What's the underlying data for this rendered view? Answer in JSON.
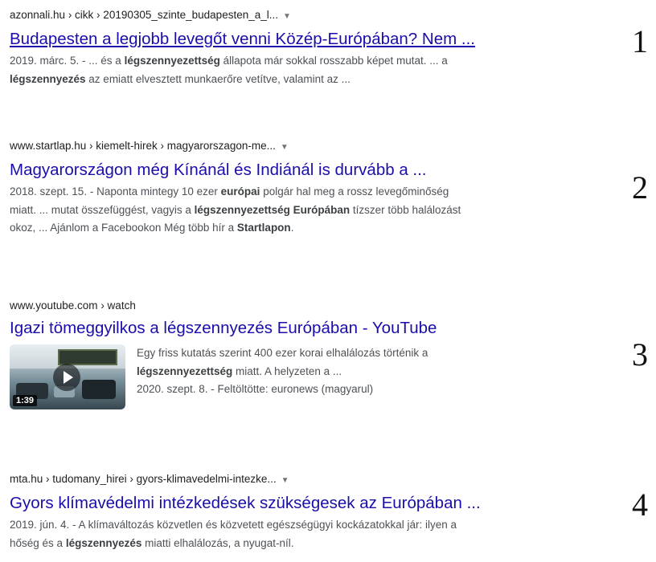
{
  "results": [
    {
      "domain": "azonnali.hu",
      "path": " › cikk › 20190305_szinte_budapesten_a_l...",
      "title": "Budapesten a legjobb levegőt venni Közép-Európában? Nem ...",
      "visited": true,
      "snippet_1a": "2019. márc. 5. - ... és a ",
      "snippet_1b": "légszennyezettség",
      "snippet_1c": " állapota már sokkal rosszabb képet mutat. ... a",
      "snippet_2a": "légszennyezés",
      "snippet_2b": " az emiatt elvesztett munkaerőre vetítve, valamint az ...",
      "number": "1"
    },
    {
      "domain": "www.startlap.hu",
      "path": " › kiemelt-hirek › magyarorszagon-me...",
      "title": "Magyarországon még Kínánál és Indiánál is durvább a ...",
      "snippet_1a": "2018. szept. 15. - Naponta mintegy 10 ezer ",
      "snippet_1b": "európai",
      "snippet_1c": " polgár hal meg a rossz levegőminőség",
      "snippet_2a": "miatt. ... mutat összefüggést, vagyis a ",
      "snippet_2b": "légszennyezettség Európában",
      "snippet_2c": " tízszer több halálozást",
      "snippet_3a": "okoz, ... Ajánlom a Facebookon Még több hír a ",
      "snippet_3b": "Startlapon",
      "snippet_3c": ".",
      "number": "2"
    },
    {
      "domain": "www.youtube.com",
      "path": " › watch",
      "title": "Igazi tömeggyilkos a légszennyezés Európában - YouTube",
      "video_line1": "Egy friss kutatás szerint 400 ezer korai elhalálozás történik a",
      "video_line2a": "légszennyezettség",
      "video_line2b": " miatt. A helyzeten a ...",
      "video_meta": "2020. szept. 8. - Feltöltötte: euronews (magyarul)",
      "duration": "1:39",
      "number": "3"
    },
    {
      "domain": "mta.hu",
      "path": " › tudomany_hirei › gyors-klimavedelmi-intezke...",
      "title": "Gyors klímavédelmi intézkedések szükségesek az Európában ...",
      "snippet_1a": "2019. jún. 4. - A klímaváltozás közvetlen és közvetett egészségügyi kockázatokkal jár: ilyen a",
      "snippet_2a": "hőség és a ",
      "snippet_2b": "légszennyezés",
      "snippet_2c": " miatti elhalálozás, a nyugat-níl.",
      "number": "4"
    }
  ],
  "icons": {
    "dropdown": "caret-down-icon",
    "play": "play-icon"
  },
  "colors": {
    "link": "#1a0dab",
    "snippet": "#4d5156",
    "crumb": "#202124"
  }
}
